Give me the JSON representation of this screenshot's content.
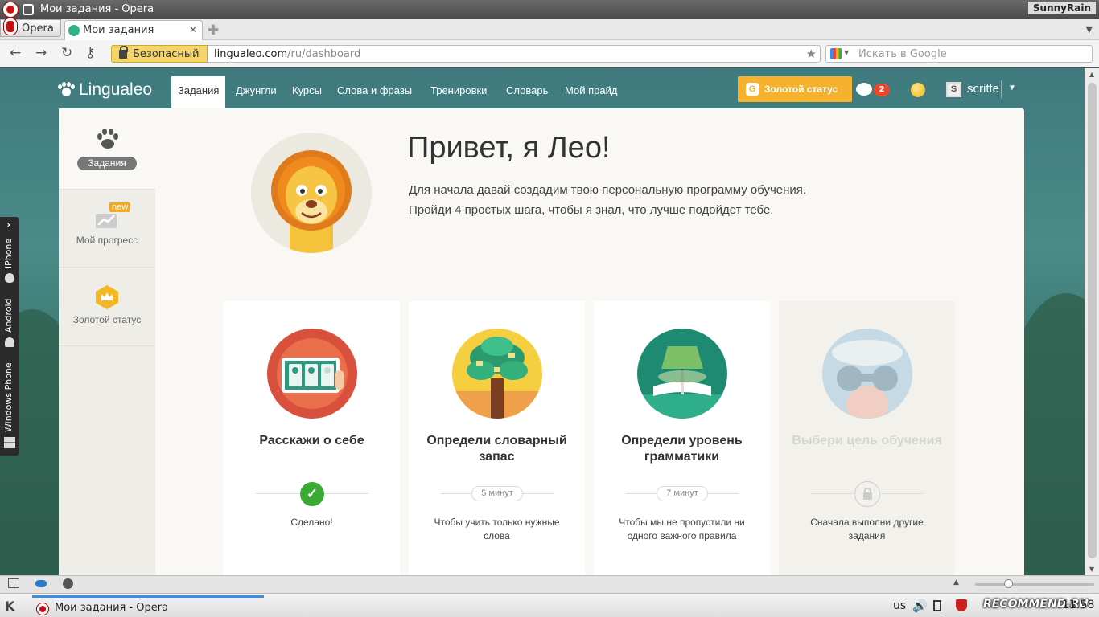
{
  "window": {
    "title": "Мои задания - Opera",
    "user_badge": "SunnyRain"
  },
  "browser": {
    "menu_label": "Opera",
    "tab_title": "Мои задания",
    "secure_label": "Безопасный",
    "url_host": "lingualeo.com",
    "url_path": "/ru/dashboard",
    "search_placeholder": "Искать в Google"
  },
  "site": {
    "logo": "Lingualeo",
    "nav": [
      "Задания",
      "Джунгли",
      "Курсы",
      "Слова и фразы",
      "Тренировки",
      "Словарь",
      "Мой прайд"
    ],
    "gold_button": "Золотой статус",
    "gold_icon": "G",
    "notifications": "2",
    "username": "scritte",
    "avatar_letter": "S"
  },
  "sidebar": {
    "tasks": "Задания",
    "progress": "Мой прогресс",
    "progress_badge": "new",
    "gold": "Золотой статус"
  },
  "hero": {
    "title": "Привет, я Лео!",
    "line1": "Для начала давай создадим твою персональную программу обучения.",
    "line2": "Пройди 4 простых шага, чтобы я знал, что лучше подойдет тебе."
  },
  "cards": [
    {
      "title": "Расскажи о себе",
      "status": "done",
      "desc": "Сделано!"
    },
    {
      "title": "Определи словарный запас",
      "time": "5 минут",
      "desc": "Чтобы учить только нужные слова"
    },
    {
      "title": "Определи уровень грамматики",
      "time": "7 минут",
      "desc": "Чтобы мы не пропустили ни одного важного правила"
    },
    {
      "title": "Выбери цель обучения",
      "status": "locked",
      "desc": "Сначала выполни другие задания"
    }
  ],
  "side_tab": {
    "close": "x",
    "items": [
      "iPhone",
      "Android",
      "Windows Phone"
    ]
  },
  "taskbar": {
    "task": "Мои задания - Opera",
    "lang": "us",
    "clock": "11:58",
    "watermark": "RECOMMEND.RU"
  }
}
